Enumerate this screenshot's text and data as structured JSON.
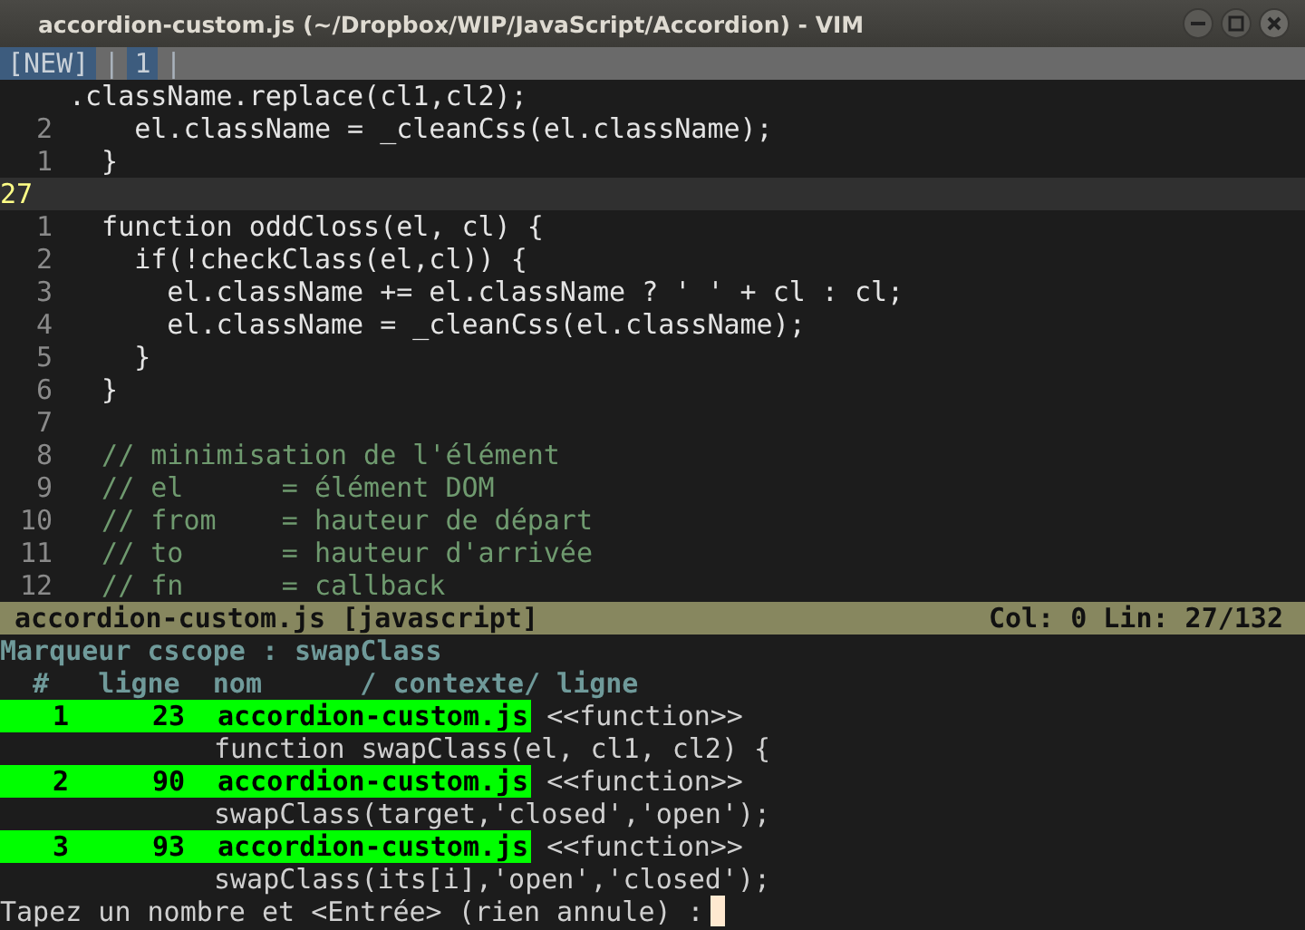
{
  "window": {
    "title": "accordion-custom.js (~/Dropbox/WIP/JavaScript/Accordion) - VIM"
  },
  "tabline": [
    {
      "kind": "tab",
      "label": "[NEW]"
    },
    {
      "kind": "separator",
      "label": "|"
    },
    {
      "kind": "tab",
      "label": "1"
    },
    {
      "kind": "separator",
      "label": "|"
    }
  ],
  "code_lines": [
    {
      "text": ".className.replace(cl1,cl2);",
      "kind": "code",
      "current": false
    },
    {
      "number": "2",
      "text": "    el.className = _cleanCss(el.className);",
      "kind": "code",
      "current": false
    },
    {
      "number": "1",
      "text": "  }",
      "kind": "code",
      "current": false
    },
    {
      "number": "27",
      "current": true
    },
    {
      "number": "1",
      "text": "  function oddCloss(el, cl) {",
      "kind": "code",
      "current": false
    },
    {
      "number": "2",
      "text": "    if(!checkClass(el,cl)) {",
      "kind": "code",
      "current": false
    },
    {
      "number": "3",
      "text": "      el.className += el.className ? ' ' + cl : cl;",
      "kind": "code",
      "current": false
    },
    {
      "number": "4",
      "text": "      el.className = _cleanCss(el.className);",
      "kind": "code",
      "current": false
    },
    {
      "number": "5",
      "text": "    }",
      "kind": "code",
      "current": false
    },
    {
      "number": "6",
      "text": "  }",
      "kind": "code",
      "current": false
    },
    {
      "number": "7",
      "current": false
    },
    {
      "number": "8",
      "text": "  // minimisation de l'élément",
      "kind": "comment",
      "current": false
    },
    {
      "number": "9",
      "text": "  // el      = élément DOM",
      "kind": "comment",
      "current": false
    },
    {
      "number": "10",
      "text": "  // from    = hauteur de départ",
      "kind": "comment",
      "current": false
    },
    {
      "number": "11",
      "text": "  // to      = hauteur d'arrivée",
      "kind": "comment",
      "current": false
    },
    {
      "number": "12",
      "text": "  // fn      = callback",
      "kind": "comment",
      "current": false
    }
  ],
  "status_bar": {
    "file": "accordion-custom.js [javascript]",
    "position": "Col: 0 Lin: 27/132"
  },
  "cscope": {
    "title": "Marqueur cscope : swapClass",
    "header": "  #   ligne  nom      / contexte/ ligne",
    "matches": [
      {
        "number": "1",
        "line": "23",
        "file": "accordion-custom.js",
        "tag": "<<function>>",
        "context": "function swapClass(el, cl1, cl2) {"
      },
      {
        "number": "2",
        "line": "90",
        "file": "accordion-custom.js",
        "tag": "<<function>>",
        "context": "swapClass(target,'closed','open');"
      },
      {
        "number": "3",
        "line": "93",
        "file": "accordion-custom.js",
        "tag": "<<function>>",
        "context": "swapClass(its[i],'open','closed');"
      }
    ],
    "prompt": "Tapez un nombre et <Entrée> (rien annule) :"
  }
}
